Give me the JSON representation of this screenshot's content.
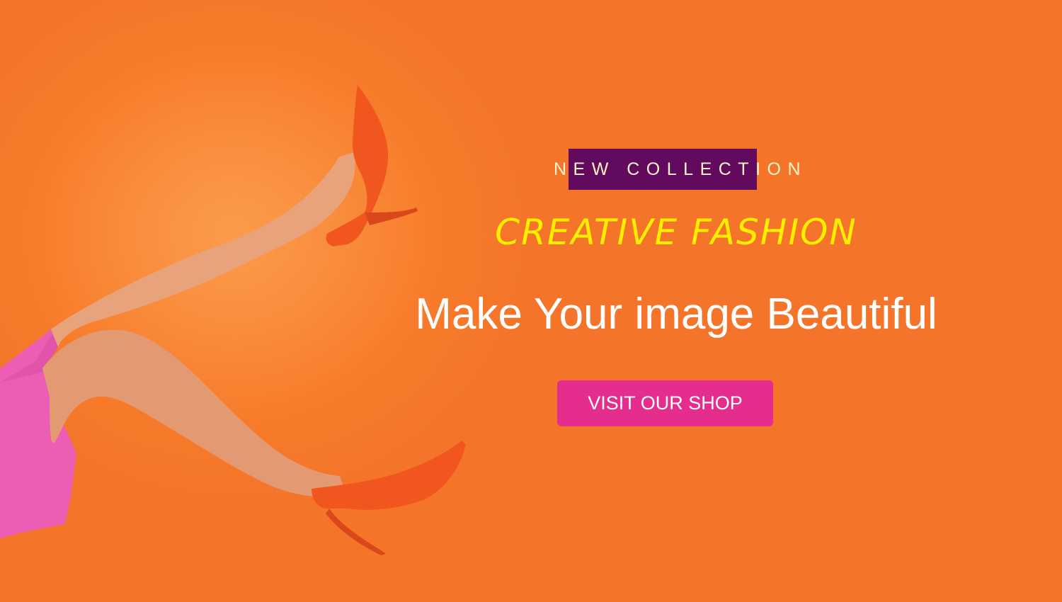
{
  "hero": {
    "eyebrow": "NEW COLLECTION",
    "headline": "CREATIVE FASHION",
    "tagline": "Make Your image Beautiful",
    "cta_label": "VISIT OUR SHOP"
  },
  "colors": {
    "background": "#f77b2a",
    "background_glow": "#fb9c4b",
    "eyebrow_highlight": "#620a5e",
    "eyebrow_text": "#fff4c8",
    "headline": "#ffee00",
    "tagline": "#ffffff",
    "cta_background": "#e52d8e",
    "shoe": "#f0561e",
    "skirt": "#ec5eb4"
  }
}
